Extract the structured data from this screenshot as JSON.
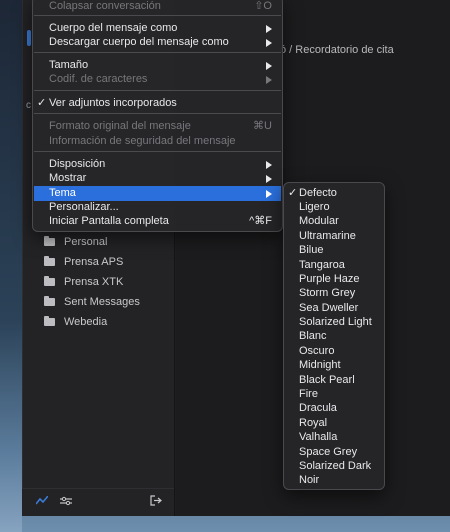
{
  "breadcrumb": "ó / Recordatorio de cita",
  "sidebar": {
    "folders": [
      {
        "label": "Personal"
      },
      {
        "label": "Prensa APS"
      },
      {
        "label": "Prensa XTK"
      },
      {
        "label": "Sent Messages"
      },
      {
        "label": "Webedia"
      }
    ]
  },
  "menu": {
    "items": [
      {
        "label": "Colapsar conversación",
        "shortcut": "⇧O",
        "disabled": true
      },
      {
        "label": "Cuerpo del mensaje como",
        "submenu": true
      },
      {
        "label": "Descargar cuerpo del mensaje como",
        "submenu": true
      },
      {
        "label": "Tamaño",
        "submenu": true
      },
      {
        "label": "Codif. de caracteres",
        "submenu": true,
        "disabled": true
      },
      {
        "label": "Ver adjuntos incorporados",
        "checked": true
      },
      {
        "label": "Formato original del mensaje",
        "shortcut": "⌘U",
        "disabled": true
      },
      {
        "label": "Información de seguridad del mensaje",
        "disabled": true
      },
      {
        "label": "Disposición",
        "submenu": true
      },
      {
        "label": "Mostrar",
        "submenu": true
      },
      {
        "label": "Tema",
        "submenu": true,
        "highlighted": true
      },
      {
        "label": "Personalizar..."
      },
      {
        "label": "Iniciar Pantalla completa",
        "shortcut": "^⌘F"
      }
    ]
  },
  "theme_submenu": {
    "items": [
      {
        "label": "Defecto",
        "checked": true
      },
      {
        "label": "Ligero"
      },
      {
        "label": "Modular"
      },
      {
        "label": "Ultramarine"
      },
      {
        "label": "Bilue"
      },
      {
        "label": "Tangaroa"
      },
      {
        "label": "Purple Haze"
      },
      {
        "label": "Storm Grey"
      },
      {
        "label": "Sea Dweller"
      },
      {
        "label": "Solarized Light"
      },
      {
        "label": "Blanc"
      },
      {
        "label": "Oscuro"
      },
      {
        "label": "Midnight"
      },
      {
        "label": "Black Pearl"
      },
      {
        "label": "Fire"
      },
      {
        "label": "Dracula"
      },
      {
        "label": "Royal"
      },
      {
        "label": "Valhalla"
      },
      {
        "label": "Space Grey"
      },
      {
        "label": "Solarized Dark"
      },
      {
        "label": "Noir"
      }
    ]
  },
  "icons": {
    "check": "✓",
    "activity": "activity-icon",
    "sliders": "sliders-icon",
    "logout": "logout-icon"
  },
  "colors": {
    "highlight": "#2a6fdb",
    "menu_bg": "#262628",
    "text": "#e9e9ec",
    "disabled_text": "#77777c"
  }
}
